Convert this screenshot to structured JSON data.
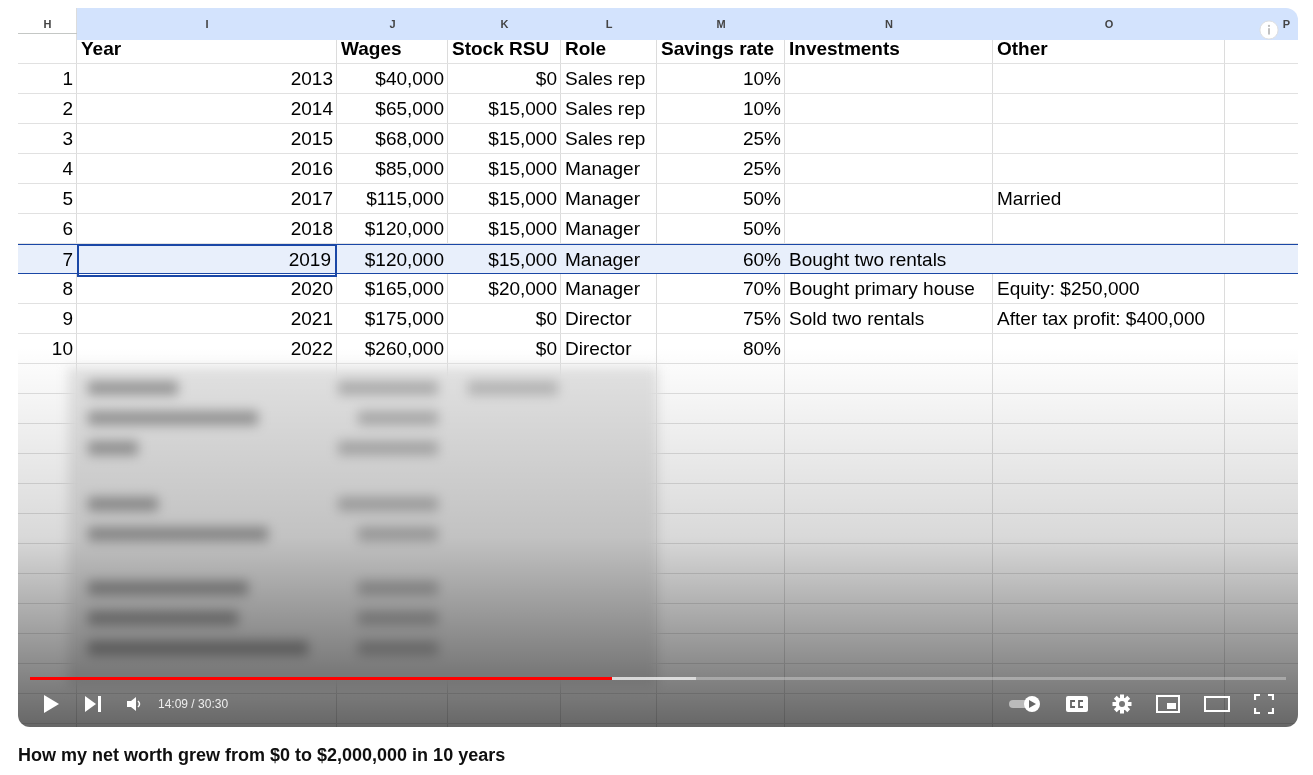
{
  "sheet": {
    "corner_letter": "H",
    "columns": [
      {
        "letter": "I",
        "kind": "number",
        "header": "Year"
      },
      {
        "letter": "J",
        "kind": "number",
        "header": "Wages"
      },
      {
        "letter": "K",
        "kind": "number",
        "header": "Stock RSU"
      },
      {
        "letter": "L",
        "kind": "text",
        "header": "Role"
      },
      {
        "letter": "M",
        "kind": "number",
        "header": "Savings rate"
      },
      {
        "letter": "N",
        "kind": "text",
        "header": "Investments"
      },
      {
        "letter": "O",
        "kind": "text",
        "header": "Other"
      },
      {
        "letter": "P",
        "kind": "text"
      }
    ],
    "rows": [
      {
        "number": "1",
        "cells": [
          "2013",
          "$40,000",
          "$0",
          "Sales rep",
          "10%",
          "",
          ""
        ],
        "selected": false
      },
      {
        "number": "2",
        "cells": [
          "2014",
          "$65,000",
          "$15,000",
          "Sales rep",
          "10%",
          "",
          ""
        ],
        "selected": false
      },
      {
        "number": "3",
        "cells": [
          "2015",
          "$68,000",
          "$15,000",
          "Sales rep",
          "25%",
          "",
          ""
        ],
        "selected": false
      },
      {
        "number": "4",
        "cells": [
          "2016",
          "$85,000",
          "$15,000",
          "Manager",
          "25%",
          "",
          ""
        ],
        "selected": false
      },
      {
        "number": "5",
        "cells": [
          "2017",
          "$115,000",
          "$15,000",
          "Manager",
          "50%",
          "",
          "Married"
        ],
        "selected": false
      },
      {
        "number": "6",
        "cells": [
          "2018",
          "$120,000",
          "$15,000",
          "Manager",
          "50%",
          "",
          ""
        ],
        "selected": false
      },
      {
        "number": "7",
        "cells": [
          "2019",
          "$120,000",
          "$15,000",
          "Manager",
          "60%",
          "Bought two rentals",
          ""
        ],
        "selected": true
      },
      {
        "number": "8",
        "cells": [
          "2020",
          "$165,000",
          "$20,000",
          "Manager",
          "70%",
          "Bought primary house",
          "Equity: $250,000"
        ],
        "selected": false
      },
      {
        "number": "9",
        "cells": [
          "2021",
          "$175,000",
          "$0",
          "Director",
          "75%",
          "Sold two rentals",
          "After tax profit: $400,000"
        ],
        "selected": false
      },
      {
        "number": "10",
        "cells": [
          "2022",
          "$260,000",
          "$0",
          "Director",
          "80%",
          "",
          ""
        ],
        "selected": false
      }
    ]
  },
  "player": {
    "progress": {
      "level": 0.463
    },
    "buffer": {
      "level": 0.53
    },
    "time": "14:09 / 30:30"
  },
  "video_title": "How my net worth grew from $0 to $2,000,000 in 10 years"
}
